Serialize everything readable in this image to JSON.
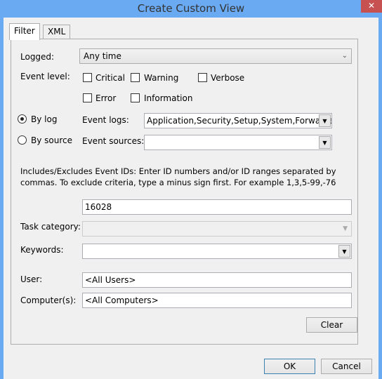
{
  "window": {
    "title": "Create Custom View",
    "close_icon": "close-icon"
  },
  "tabs": [
    {
      "label": "Filter",
      "active": true
    },
    {
      "label": "XML",
      "active": false
    }
  ],
  "filter": {
    "logged_label": "Logged:",
    "logged_value": "Any time",
    "event_level_label": "Event level:",
    "levels": [
      {
        "label": "Critical",
        "checked": false
      },
      {
        "label": "Warning",
        "checked": false
      },
      {
        "label": "Verbose",
        "checked": false
      },
      {
        "label": "Error",
        "checked": false
      },
      {
        "label": "Information",
        "checked": false
      }
    ],
    "by_log_label": "By log",
    "by_log_selected": true,
    "by_source_label": "By source",
    "by_source_selected": false,
    "event_logs_label": "Event logs:",
    "event_logs_value": "Application,Security,Setup,System,Forwarded Events",
    "event_sources_label": "Event sources:",
    "event_sources_value": "",
    "ids_help": "Includes/Excludes Event IDs: Enter ID numbers and/or ID ranges separated by commas. To exclude criteria, type a minus sign first. For example 1,3,5-99,-76",
    "ids_value": "16028",
    "task_category_label": "Task category:",
    "task_category_value": "",
    "keywords_label": "Keywords:",
    "keywords_value": "",
    "user_label": "User:",
    "user_value": "<All Users>",
    "computer_label": "Computer(s):",
    "computer_value": "<All Computers>",
    "clear_label": "Clear"
  },
  "footer": {
    "ok_label": "OK",
    "cancel_label": "Cancel"
  }
}
